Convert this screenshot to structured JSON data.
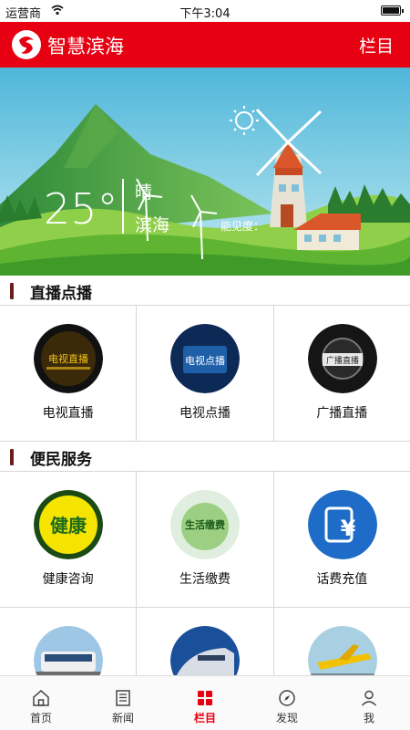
{
  "status_bar": {
    "carrier": "运营商",
    "time": "下午3:04"
  },
  "header": {
    "title": "智慧滨海",
    "menu": "栏目"
  },
  "weather": {
    "temperature": "25°",
    "condition": "晴",
    "city": "滨海",
    "visibility": "能见度："
  },
  "live_section": {
    "title": "直播点播",
    "items": [
      {
        "label": "电视直播",
        "icon": "tv-live-icon"
      },
      {
        "label": "电视点播",
        "icon": "tv-vod-icon"
      },
      {
        "label": "广播直播",
        "icon": "radio-live-icon"
      }
    ]
  },
  "service_section": {
    "title": "便民服务",
    "items": [
      {
        "label": "健康咨询",
        "icon": "health-icon"
      },
      {
        "label": "生活缴费",
        "icon": "utility-payment-icon"
      },
      {
        "label": "话费充值",
        "icon": "phone-recharge-icon"
      },
      {
        "label": "",
        "icon": "bus-icon"
      },
      {
        "label": "",
        "icon": "train-icon"
      },
      {
        "label": "",
        "icon": "plane-icon"
      }
    ]
  },
  "tabbar": [
    {
      "label": "首页",
      "icon": "home-icon",
      "active": false
    },
    {
      "label": "新闻",
      "icon": "news-icon",
      "active": false
    },
    {
      "label": "栏目",
      "icon": "columns-icon",
      "active": true
    },
    {
      "label": "发现",
      "icon": "compass-icon",
      "active": false
    },
    {
      "label": "我",
      "icon": "user-icon",
      "active": false
    }
  ],
  "colors": {
    "brand": "#e60012",
    "section_bar": "#6b1e1e"
  }
}
